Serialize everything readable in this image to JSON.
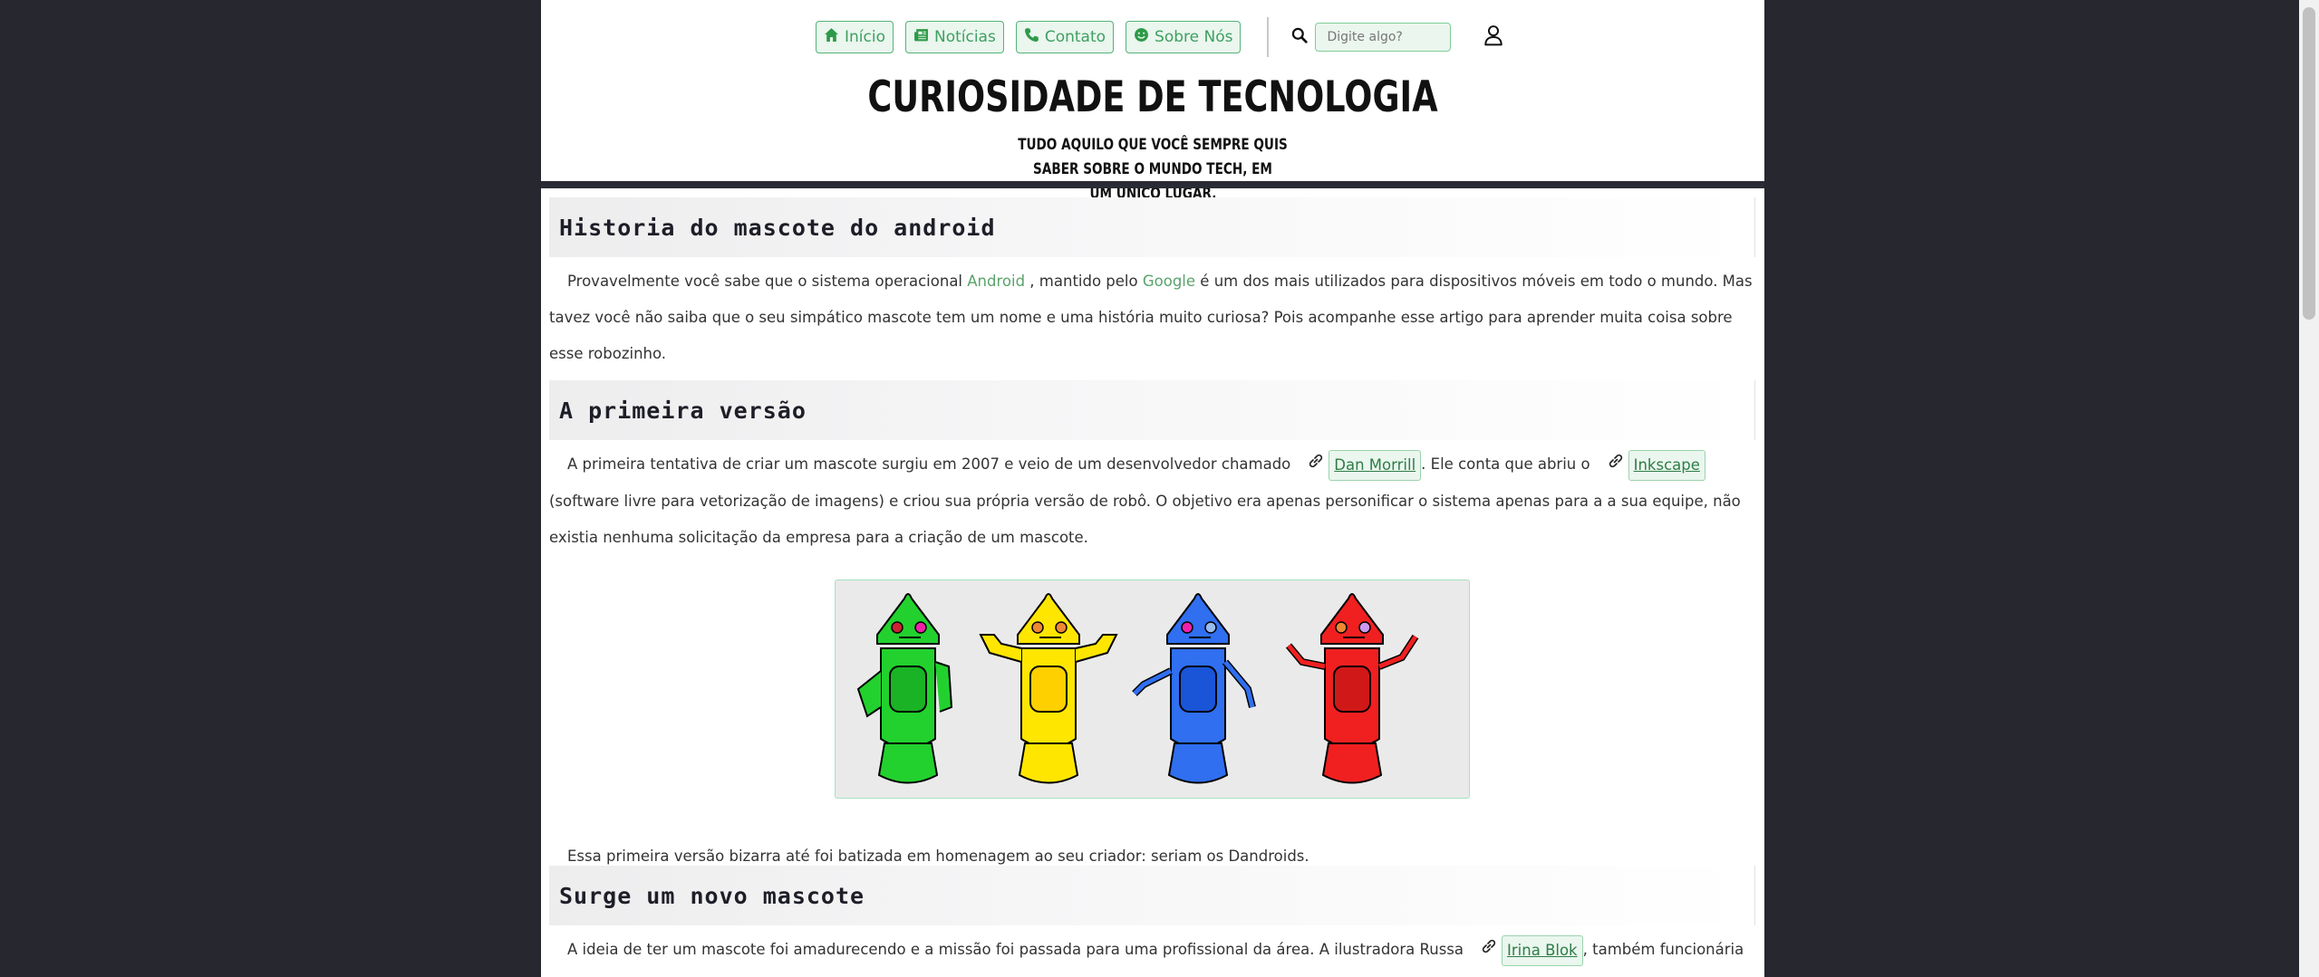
{
  "nav": {
    "items": [
      {
        "label": "Início",
        "icon": "home-icon"
      },
      {
        "label": "Notícias",
        "icon": "newspaper-icon"
      },
      {
        "label": "Contato",
        "icon": "phone-icon"
      },
      {
        "label": "Sobre Nós",
        "icon": "smile-icon"
      }
    ],
    "search_placeholder": "Digite algo?"
  },
  "site": {
    "title": "CURIOSIDADE DE TECNOLOGIA",
    "subtitle_line1": "Tudo aquilo que você sempre quis saber sobre o mundo tech, em",
    "subtitle_line2": "um único lugar."
  },
  "sections": [
    {
      "heading": "Historia do mascote do android",
      "para": {
        "t1": "Provavelmente você sabe que o sistema operacional ",
        "link1": "Android",
        "t2": " , mantido pelo ",
        "link2": "Google",
        "t3": "  é um dos mais utilizados para dispositivos móveis em todo o mundo. Mas tavez você não saiba que o seu simpático mascote tem um nome e uma história muito curiosa? Pois acompanhe esse artigo para aprender muita coisa sobre esse robozinho."
      }
    },
    {
      "heading": "A primeira versão",
      "para": {
        "t1": "A primeira tentativa de criar um mascote surgiu em 2007 e veio de um desenvolvedor chamado",
        "link1": " Dan Morrill",
        "t2": ". Ele conta que abriu o",
        "link2": " Inkscape",
        "t3": " (software livre para vetorização de imagens) e criou sua própria versão de robô. O objetivo era apenas personificar o sistema apenas para a a sua equipe, não existia nenhuma solicitação da empresa para a criação de um mascote."
      },
      "after_figure": "Essa primeira versão bizarra até foi batizada em homenagem ao seu criador: seriam os Dandroids."
    },
    {
      "heading": "Surge um novo mascote",
      "para": {
        "t1": "A ideia de ter um mascote foi amadurecendo e a missão foi passada para uma profissional da área. A ilustradora Russa",
        "link1": " Irina Blok",
        "t2": ", também funcionária do"
      }
    }
  ],
  "figure": {
    "robots": [
      {
        "name": "green-robot",
        "color": "#22d12e"
      },
      {
        "name": "yellow-robot",
        "color": "#ffe600"
      },
      {
        "name": "blue-robot",
        "color": "#2f6ff0"
      },
      {
        "name": "red-robot",
        "color": "#f02020"
      }
    ]
  },
  "colors": {
    "accent": "#3ea060",
    "background": "#272730",
    "header_bar": "#2a2b34"
  }
}
